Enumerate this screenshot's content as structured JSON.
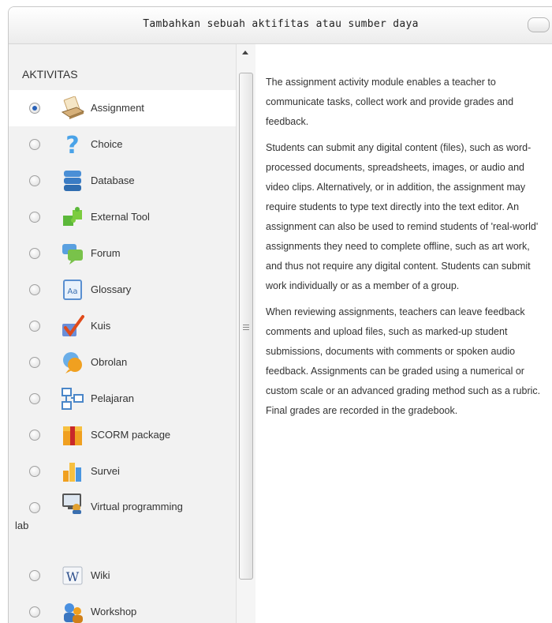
{
  "dialog": {
    "title": "Tambahkan sebuah aktifitas atau sumber daya"
  },
  "section_label": "AKTIVITAS",
  "options": [
    {
      "label": "Assignment",
      "selected": true,
      "icon": "assignment-icon"
    },
    {
      "label": "Choice",
      "selected": false,
      "icon": "choice-icon"
    },
    {
      "label": "Database",
      "selected": false,
      "icon": "database-icon"
    },
    {
      "label": "External Tool",
      "selected": false,
      "icon": "external-tool-icon"
    },
    {
      "label": "Forum",
      "selected": false,
      "icon": "forum-icon"
    },
    {
      "label": "Glossary",
      "selected": false,
      "icon": "glossary-icon"
    },
    {
      "label": "Kuis",
      "selected": false,
      "icon": "quiz-icon"
    },
    {
      "label": "Obrolan",
      "selected": false,
      "icon": "chat-icon"
    },
    {
      "label": "Pelajaran",
      "selected": false,
      "icon": "lesson-icon"
    },
    {
      "label": "SCORM package",
      "selected": false,
      "icon": "scorm-package-icon"
    },
    {
      "label": "Survei",
      "selected": false,
      "icon": "survey-icon"
    },
    {
      "label": "Virtual programming",
      "label_tail": "lab",
      "selected": false,
      "icon": "virtual-programming-lab-icon"
    },
    {
      "label": "Wiki",
      "selected": false,
      "icon": "wiki-icon"
    },
    {
      "label": "Workshop",
      "selected": false,
      "icon": "workshop-icon"
    }
  ],
  "help": {
    "paragraphs": [
      "The assignment activity module enables a teacher to communicate tasks, collect work and provide grades and feedback.",
      "Students can submit any digital content (files), such as word-processed documents, spreadsheets, images, or audio and video clips. Alternatively, or in addition, the assignment may require students to type text directly into the text editor. An assignment can also be used to remind students of 'real-world' assignments they need to complete offline, such as art work, and thus not require any digital content. Students can submit work individually or as a member of a group.",
      "When reviewing assignments, teachers can leave feedback comments and upload files, such as marked-up student submissions, documents with comments or spoken audio feedback. Assignments can be graded using a numerical or custom scale or an advanced grading method such as a rubric. Final grades are recorded in the gradebook."
    ]
  },
  "colors": {
    "radio_selected": "#2a62b8",
    "panel_bg": "#f2f2f2",
    "selected_row_bg": "#ffffff"
  }
}
